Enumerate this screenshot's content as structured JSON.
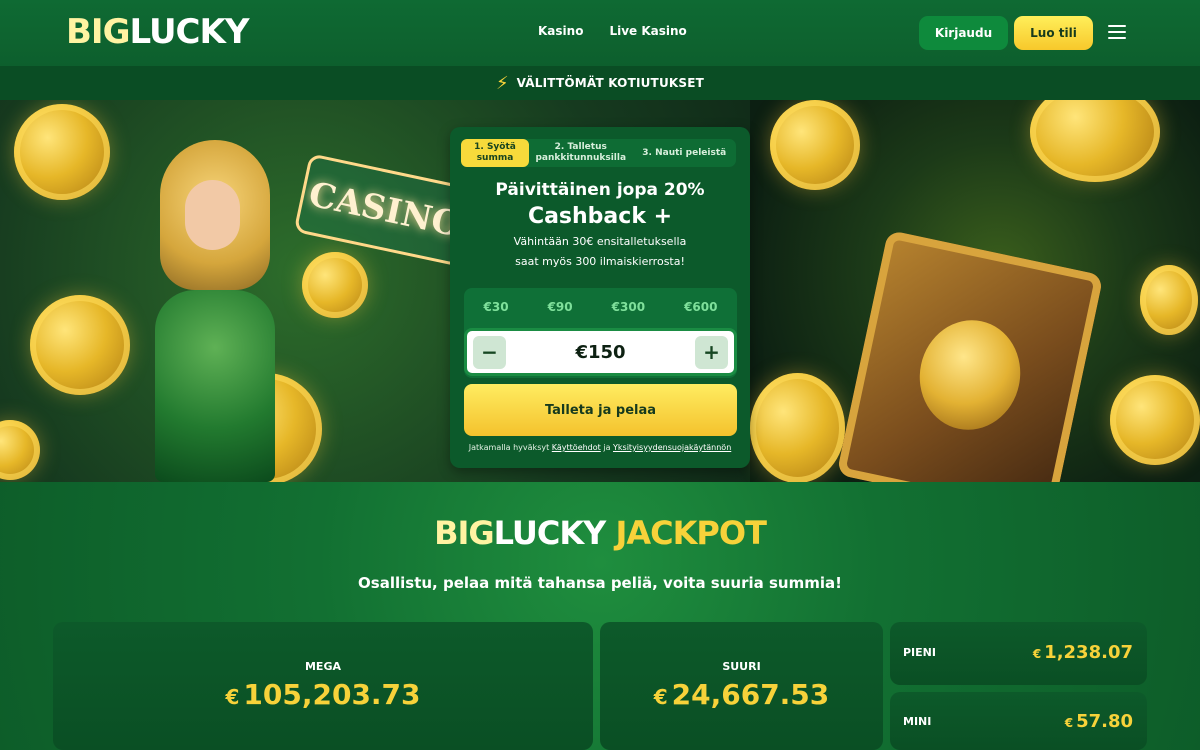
{
  "header": {
    "logo_big": "BIG",
    "logo_lucky": "LUCKY",
    "nav": [
      {
        "label": "Kasino"
      },
      {
        "label": "Live Kasino"
      }
    ],
    "login_label": "Kirjaudu",
    "register_label": "Luo tili",
    "menu_icon": "hamburger-menu-icon"
  },
  "promo_strip": {
    "icon": "lightning-bolt-icon",
    "text": "VÄLITTÖMÄT KOTIUTUKSET"
  },
  "hero": {
    "sign_text": "CASINO"
  },
  "deposit_card": {
    "steps": [
      {
        "label": "1. Syötä summa",
        "active": true
      },
      {
        "label": "2. Talletus pankkitunnuksilla",
        "active": false
      },
      {
        "label": "3. Nauti peleistä",
        "active": false
      }
    ],
    "title_line1": "Päivittäinen jopa 20%",
    "title_line2": "Cashback +",
    "subtitle_line1": "Vähintään 30€ ensitalletuksella",
    "subtitle_line2": "saat myös 300 ilmaiskierrosta!",
    "presets": [
      "€30",
      "€90",
      "€300",
      "€600"
    ],
    "amount_value": "€150",
    "minus_label": "−",
    "plus_label": "+",
    "cta_label": "Talleta ja pelaa",
    "terms_prefix": "Jatkamalla hyväksyt",
    "terms_link": "Käyttöehdot",
    "terms_and": "ja",
    "privacy_link": "Yksityisyydensuojakäytännön"
  },
  "jackpot": {
    "logo_big": "BIG",
    "logo_lucky": "LUCKY",
    "logo_jackpot": "JACKPOT",
    "tagline": "Osallistu, pelaa mitä tahansa peliä, voita suuria summia!",
    "currency": "€",
    "mega_label": "MEGA",
    "mega_value": "105,203.73",
    "suuri_label": "SUURI",
    "suuri_value": "24,667.53",
    "pieni_label": "PIENI",
    "pieni_value": "1,238.07",
    "mini_label": "MINI",
    "mini_value": "57.80"
  },
  "colors": {
    "brand_green": "#0d5f2d",
    "accent_yellow": "#f7d23a",
    "login_button": "#0e8a3c"
  }
}
